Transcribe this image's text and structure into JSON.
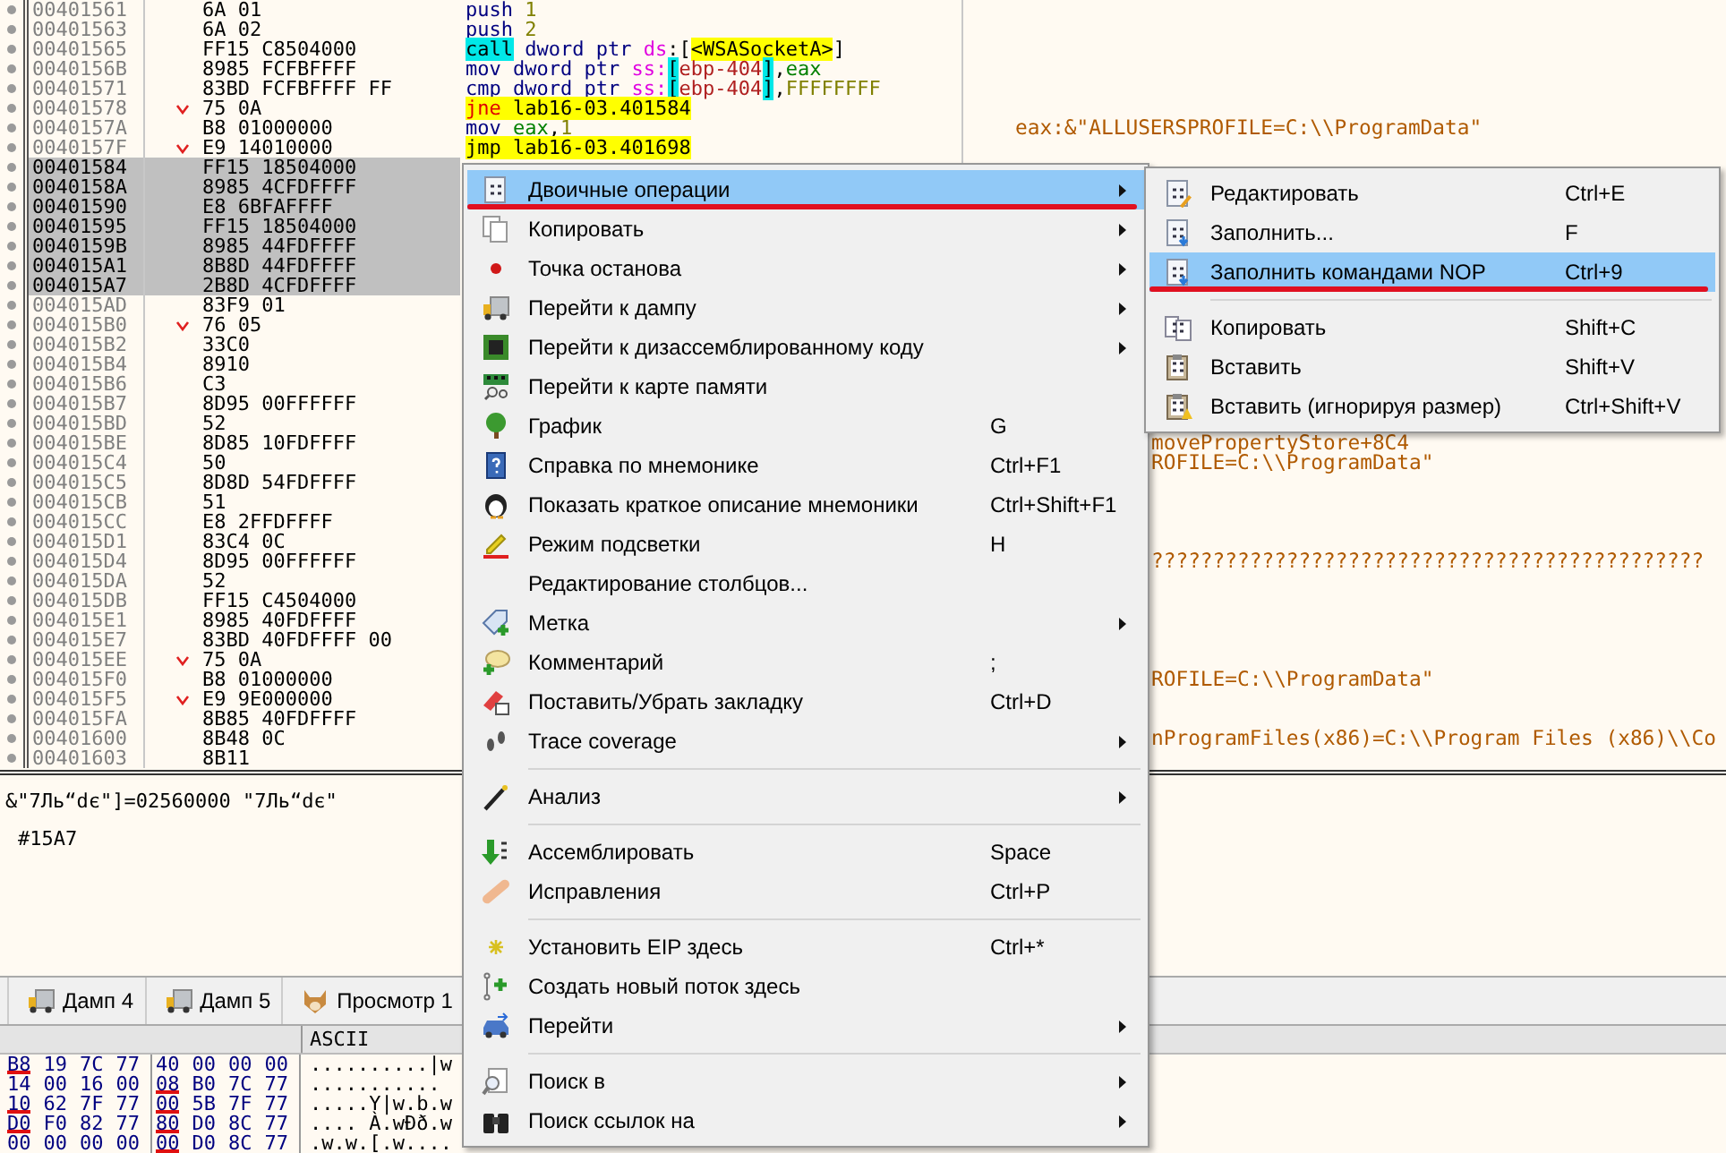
{
  "disassembly": {
    "rows": [
      {
        "address": "00401561",
        "bytes": "6A 01",
        "selected": false,
        "branch": false,
        "code": [
          {
            "text": "push ",
            "kind": "mnemonic"
          },
          {
            "text": "1",
            "kind": "number"
          }
        ]
      },
      {
        "address": "00401563",
        "bytes": "6A 02",
        "selected": false,
        "branch": false,
        "code": [
          {
            "text": "push ",
            "kind": "mnemonic"
          },
          {
            "text": "2",
            "kind": "number"
          }
        ]
      },
      {
        "address": "00401565",
        "bytes": "FF15 C8504000",
        "selected": false,
        "branch": false,
        "code": [
          {
            "text": "call",
            "kind": "call"
          },
          {
            "text": " dword ptr ",
            "kind": "size"
          },
          {
            "text": "ds",
            "kind": "segment"
          },
          {
            "text": ":[",
            "kind": "plain"
          },
          {
            "text": "<WSASocketA>",
            "kind": "label"
          },
          {
            "text": "]",
            "kind": "plain"
          }
        ]
      },
      {
        "address": "0040156B",
        "bytes": "8985 FCFBFFFF",
        "selected": false,
        "branch": false,
        "code": [
          {
            "text": "mov",
            "kind": "mnemonic"
          },
          {
            "text": " dword ptr ",
            "kind": "size"
          },
          {
            "text": "ss:",
            "kind": "segment"
          },
          {
            "text": "[",
            "kind": "bracket"
          },
          {
            "text": "ebp-404",
            "kind": "memory"
          },
          {
            "text": "]",
            "kind": "bracket"
          },
          {
            "text": ",",
            "kind": "plain"
          },
          {
            "text": "eax",
            "kind": "register"
          }
        ]
      },
      {
        "address": "00401571",
        "bytes": "83BD FCFBFFFF FF",
        "selected": false,
        "branch": false,
        "code": [
          {
            "text": "cmp",
            "kind": "mnemonic"
          },
          {
            "text": " dword ptr ",
            "kind": "size"
          },
          {
            "text": "ss:",
            "kind": "segment"
          },
          {
            "text": "[",
            "kind": "bracket"
          },
          {
            "text": "ebp-404",
            "kind": "memory"
          },
          {
            "text": "]",
            "kind": "bracket"
          },
          {
            "text": ",",
            "kind": "plain"
          },
          {
            "text": "FFFFFFFF",
            "kind": "number"
          }
        ]
      },
      {
        "address": "00401578",
        "bytes": "75 0A",
        "selected": false,
        "branch": true,
        "code": [
          {
            "text": "jne ",
            "kind": "jcc"
          },
          {
            "text": "lab16-03.401584",
            "kind": "label"
          }
        ]
      },
      {
        "address": "0040157A",
        "bytes": "B8 01000000",
        "selected": false,
        "branch": false,
        "code": [
          {
            "text": "mov ",
            "kind": "mnemonic"
          },
          {
            "text": "eax",
            "kind": "register"
          },
          {
            "text": ",",
            "kind": "plain"
          },
          {
            "text": "1",
            "kind": "number"
          }
        ],
        "comment": "eax:&\"ALLUSERSPROFILE=C:\\\\ProgramData\""
      },
      {
        "address": "0040157F",
        "bytes": "E9 14010000",
        "selected": false,
        "branch": true,
        "code": [
          {
            "text": "jmp ",
            "kind": "jmp"
          },
          {
            "text": "lab16-03.401698",
            "kind": "label"
          }
        ]
      },
      {
        "address": "00401584",
        "bytes": "FF15 18504000",
        "selected": true,
        "branch": false
      },
      {
        "address": "0040158A",
        "bytes": "8985 4CFDFFFF",
        "selected": true,
        "branch": false
      },
      {
        "address": "00401590",
        "bytes": "E8 6BFAFFFF",
        "selected": true,
        "branch": false
      },
      {
        "address": "00401595",
        "bytes": "FF15 18504000",
        "selected": true,
        "branch": false
      },
      {
        "address": "0040159B",
        "bytes": "8985 44FDFFFF",
        "selected": true,
        "branch": false
      },
      {
        "address": "004015A1",
        "bytes": "8B8D 44FDFFFF",
        "selected": true,
        "branch": false
      },
      {
        "address": "004015A7",
        "bytes": "2B8D 4CFDFFFF",
        "selected": true,
        "branch": false
      },
      {
        "address": "004015AD",
        "bytes": "83F9 01",
        "selected": false,
        "branch": false
      },
      {
        "address": "004015B0",
        "bytes": "76 05",
        "selected": false,
        "branch": true
      },
      {
        "address": "004015B2",
        "bytes": "33C0",
        "selected": false,
        "branch": false
      },
      {
        "address": "004015B4",
        "bytes": "8910",
        "selected": false,
        "branch": false
      },
      {
        "address": "004015B6",
        "bytes": "C3",
        "selected": false,
        "branch": false
      },
      {
        "address": "004015B7",
        "bytes": "8D95 00FFFFFF",
        "selected": false,
        "branch": false
      },
      {
        "address": "004015BD",
        "bytes": "52",
        "selected": false,
        "branch": false
      },
      {
        "address": "004015BE",
        "bytes": "8D85 10FDFFFF",
        "selected": false,
        "branch": false,
        "comment": "movePropertyStore+8C4",
        "comment_covered": true
      },
      {
        "address": "004015C4",
        "bytes": "50",
        "selected": false,
        "branch": false,
        "comment": "ROFILE=C:\\\\ProgramData\"",
        "comment_covered": true
      },
      {
        "address": "004015C5",
        "bytes": "8D8D 54FDFFFF",
        "selected": false,
        "branch": false
      },
      {
        "address": "004015CB",
        "bytes": "51",
        "selected": false,
        "branch": false
      },
      {
        "address": "004015CC",
        "bytes": "E8 2FFDFFFF",
        "selected": false,
        "branch": false
      },
      {
        "address": "004015D1",
        "bytes": "83C4 0C",
        "selected": false,
        "branch": false
      },
      {
        "address": "004015D4",
        "bytes": "8D95 00FFFFFF",
        "selected": false,
        "branch": false,
        "comment": "?????????????????????????????????????????????",
        "comment_covered": true
      },
      {
        "address": "004015DA",
        "bytes": "52",
        "selected": false,
        "branch": false
      },
      {
        "address": "004015DB",
        "bytes": "FF15 C4504000",
        "selected": false,
        "branch": false
      },
      {
        "address": "004015E1",
        "bytes": "8985 40FDFFFF",
        "selected": false,
        "branch": false
      },
      {
        "address": "004015E7",
        "bytes": "83BD 40FDFFFF 00",
        "selected": false,
        "branch": false
      },
      {
        "address": "004015EE",
        "bytes": "75 0A",
        "selected": false,
        "branch": true
      },
      {
        "address": "004015F0",
        "bytes": "B8 01000000",
        "selected": false,
        "branch": false,
        "comment": "ROFILE=C:\\\\ProgramData\"",
        "comment_covered": true
      },
      {
        "address": "004015F5",
        "bytes": "E9 9E000000",
        "selected": false,
        "branch": true
      },
      {
        "address": "004015FA",
        "bytes": "8B85 40FDFFFF",
        "selected": false,
        "branch": false
      },
      {
        "address": "00401600",
        "bytes": "8B48 0C",
        "selected": false,
        "branch": false,
        "comment": "nProgramFiles(x86)=C:\\\\Program Files (x86)\\\\Co",
        "comment_covered": true
      },
      {
        "address": "00401603",
        "bytes": "8B11",
        "selected": false,
        "branch": false
      }
    ]
  },
  "info_pane": {
    "lines": [
      "&\"7Ль“dє\"]=02560000  \"7Ль“dє\"",
      "#15A7"
    ]
  },
  "dump_tabs": [
    {
      "label": "Дамп 4",
      "selected": false
    },
    {
      "label": "Дамп 5",
      "selected": false
    },
    {
      "label": "Просмотр 1",
      "selected": false
    }
  ],
  "dump": {
    "ascii_header": "ASCII",
    "rows": [
      {
        "bytes": [
          {
            "text": "B8",
            "annotated": true
          },
          {
            "text": "19",
            "annotated": false
          },
          {
            "text": "7C",
            "annotated": false
          },
          {
            "text": "77",
            "annotated": false
          },
          {
            "text": "40",
            "annotated": false
          },
          {
            "text": "00",
            "annotated": false
          },
          {
            "text": "00",
            "annotated": false
          },
          {
            "text": "00",
            "annotated": false
          }
        ],
        "ascii": "..........|w"
      },
      {
        "bytes": [
          {
            "text": "14",
            "annotated": false
          },
          {
            "text": "00",
            "annotated": false
          },
          {
            "text": "16",
            "annotated": false
          },
          {
            "text": "00",
            "annotated": false
          },
          {
            "text": "08",
            "annotated": true
          },
          {
            "text": "B0",
            "annotated": false
          },
          {
            "text": "7C",
            "annotated": false
          },
          {
            "text": "77",
            "annotated": false
          }
        ],
        "ascii": "..........."
      },
      {
        "bytes": [
          {
            "text": "10",
            "annotated": true
          },
          {
            "text": "62",
            "annotated": false
          },
          {
            "text": "7F",
            "annotated": false
          },
          {
            "text": "77",
            "annotated": false
          },
          {
            "text": "00",
            "annotated": true
          },
          {
            "text": "5B",
            "annotated": false
          },
          {
            "text": "7F",
            "annotated": false
          },
          {
            "text": "77",
            "annotated": false
          }
        ],
        "ascii": ".....Y|w.b.w"
      },
      {
        "bytes": [
          {
            "text": "D0",
            "annotated": true
          },
          {
            "text": "F0",
            "annotated": false
          },
          {
            "text": "82",
            "annotated": false
          },
          {
            "text": "77",
            "annotated": false
          },
          {
            "text": "80",
            "annotated": true
          },
          {
            "text": "D0",
            "annotated": false
          },
          {
            "text": "8C",
            "annotated": false
          },
          {
            "text": "77",
            "annotated": false
          }
        ],
        "ascii": ".... À.wÐð.w"
      },
      {
        "bytes": [
          {
            "text": "00",
            "annotated": false
          },
          {
            "text": "00",
            "annotated": false
          },
          {
            "text": "00",
            "annotated": false
          },
          {
            "text": "00",
            "annotated": false
          },
          {
            "text": "00",
            "annotated": true
          },
          {
            "text": "D0",
            "annotated": false
          },
          {
            "text": "8C",
            "annotated": false
          },
          {
            "text": "77",
            "annotated": false
          }
        ],
        "ascii": ".w.w.[.w...."
      }
    ]
  },
  "context_menu": {
    "items": [
      {
        "kind": "item",
        "label": "Двоичные операции",
        "submenu": true,
        "selected": true,
        "annotated": true
      },
      {
        "kind": "item",
        "label": "Копировать",
        "submenu": true,
        "selected": false,
        "annotated": false
      },
      {
        "kind": "item",
        "label": "Точка останова",
        "submenu": true,
        "selected": false,
        "annotated": false
      },
      {
        "kind": "item",
        "label": "Перейти к дампу",
        "submenu": true,
        "selected": false,
        "annotated": false
      },
      {
        "kind": "item",
        "label": "Перейти к дизассемблированному коду",
        "submenu": true,
        "selected": false,
        "annotated": false
      },
      {
        "kind": "item",
        "label": "Перейти к карте памяти",
        "submenu": false,
        "selected": false,
        "annotated": false
      },
      {
        "kind": "item",
        "label": "График",
        "shortcut": "G",
        "submenu": false,
        "selected": false,
        "annotated": false
      },
      {
        "kind": "item",
        "label": "Справка по мнемонике",
        "shortcut": "Ctrl+F1",
        "submenu": false,
        "selected": false,
        "annotated": false
      },
      {
        "kind": "item",
        "label": "Показать краткое описание мнемоники",
        "shortcut": "Ctrl+Shift+F1",
        "submenu": false,
        "selected": false,
        "annotated": false
      },
      {
        "kind": "item",
        "label": "Режим подсветки",
        "shortcut": "H",
        "submenu": false,
        "selected": false,
        "annotated": false
      },
      {
        "kind": "item",
        "label": "Редактирование столбцов...",
        "submenu": false,
        "selected": false,
        "annotated": false
      },
      {
        "kind": "item",
        "label": "Метка",
        "submenu": true,
        "selected": false,
        "annotated": false
      },
      {
        "kind": "item",
        "label": "Комментарий",
        "shortcut": ";",
        "submenu": false,
        "selected": false,
        "annotated": false
      },
      {
        "kind": "item",
        "label": "Поставить/Убрать закладку",
        "shortcut": "Ctrl+D",
        "submenu": false,
        "selected": false,
        "annotated": false
      },
      {
        "kind": "item",
        "label": "Trace coverage",
        "submenu": true,
        "selected": false,
        "annotated": false
      },
      {
        "kind": "separator"
      },
      {
        "kind": "item",
        "label": "Анализ",
        "submenu": true,
        "selected": false,
        "annotated": false
      },
      {
        "kind": "separator"
      },
      {
        "kind": "item",
        "label": "Ассемблировать",
        "shortcut": "Space",
        "submenu": false,
        "selected": false,
        "annotated": false
      },
      {
        "kind": "item",
        "label": "Исправления",
        "shortcut": "Ctrl+P",
        "submenu": false,
        "selected": false,
        "annotated": false
      },
      {
        "kind": "separator"
      },
      {
        "kind": "item",
        "label": "Установить EIP здесь",
        "shortcut": "Ctrl+*",
        "submenu": false,
        "selected": false,
        "annotated": false
      },
      {
        "kind": "item",
        "label": "Создать новый поток здесь",
        "submenu": false,
        "selected": false,
        "annotated": false
      },
      {
        "kind": "item",
        "label": "Перейти",
        "submenu": true,
        "selected": false,
        "annotated": false
      },
      {
        "kind": "separator"
      },
      {
        "kind": "item",
        "label": "Поиск в",
        "submenu": true,
        "selected": false,
        "annotated": false
      },
      {
        "kind": "item",
        "label": "Поиск ссылок на",
        "submenu": true,
        "selected": false,
        "annotated": false
      }
    ]
  },
  "submenu": {
    "items": [
      {
        "kind": "item",
        "label": "Редактировать",
        "shortcut": "Ctrl+E",
        "selected": false,
        "annotated": false
      },
      {
        "kind": "item",
        "label": "Заполнить...",
        "shortcut": "F",
        "selected": false,
        "annotated": false
      },
      {
        "kind": "item",
        "label": "Заполнить командами NOP",
        "shortcut": "Ctrl+9",
        "selected": true,
        "annotated": true
      },
      {
        "kind": "separator"
      },
      {
        "kind": "item",
        "label": "Копировать",
        "shortcut": "Shift+C",
        "selected": false,
        "annotated": false
      },
      {
        "kind": "item",
        "label": "Вставить",
        "shortcut": "Shift+V",
        "selected": false,
        "annotated": false
      },
      {
        "kind": "item",
        "label": "Вставить (игнорируя размер)",
        "shortcut": "Ctrl+Shift+V",
        "selected": false,
        "annotated": false
      }
    ]
  }
}
